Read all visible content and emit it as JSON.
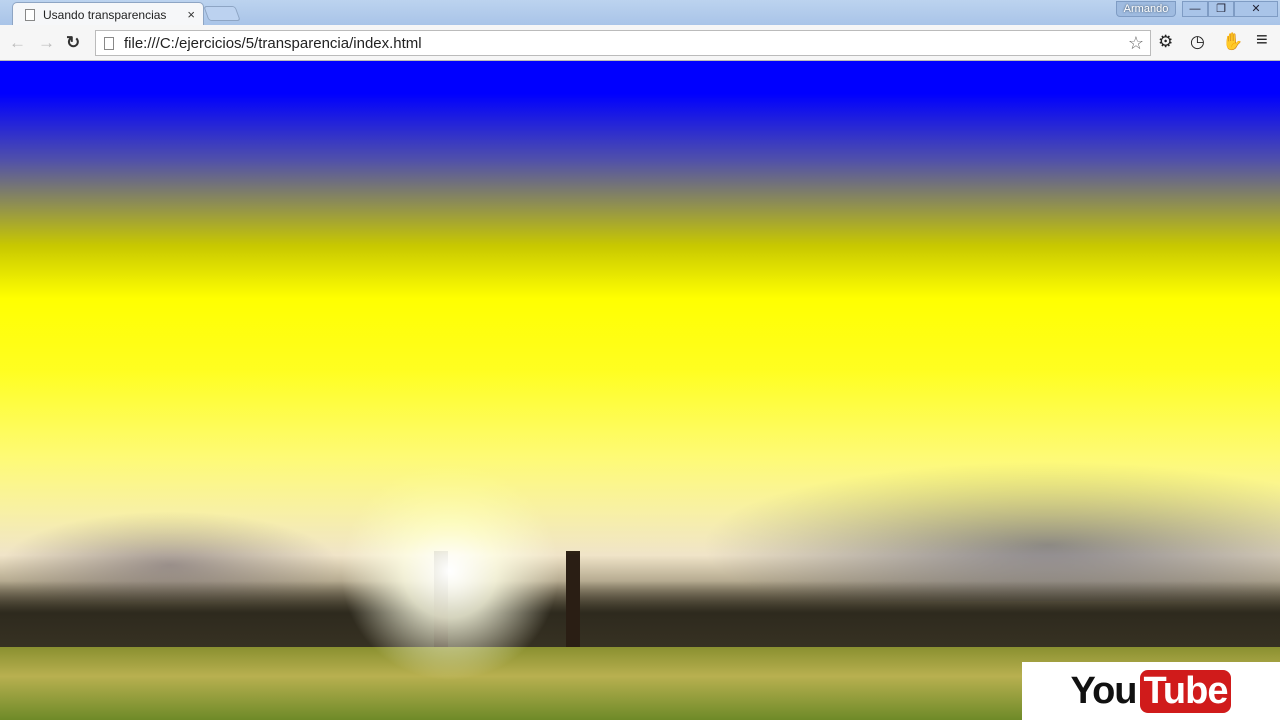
{
  "tab": {
    "title": "Usando transparencias",
    "close": "×"
  },
  "window": {
    "user": "Armando",
    "minimize": "—",
    "restore": "❐",
    "close": "✕"
  },
  "toolbar": {
    "back": "←",
    "forward": "→",
    "reload": "↻",
    "url": "file:///C:/ejercicios/5/transparencia/index.html",
    "star": "☆",
    "settings": "⚙",
    "history": "◷",
    "ext": "✋",
    "menu": "≡"
  },
  "watermark": {
    "you": "You",
    "tube": "Tube"
  },
  "colors": {
    "top": "#0000ff",
    "middle": "#ffff00"
  }
}
